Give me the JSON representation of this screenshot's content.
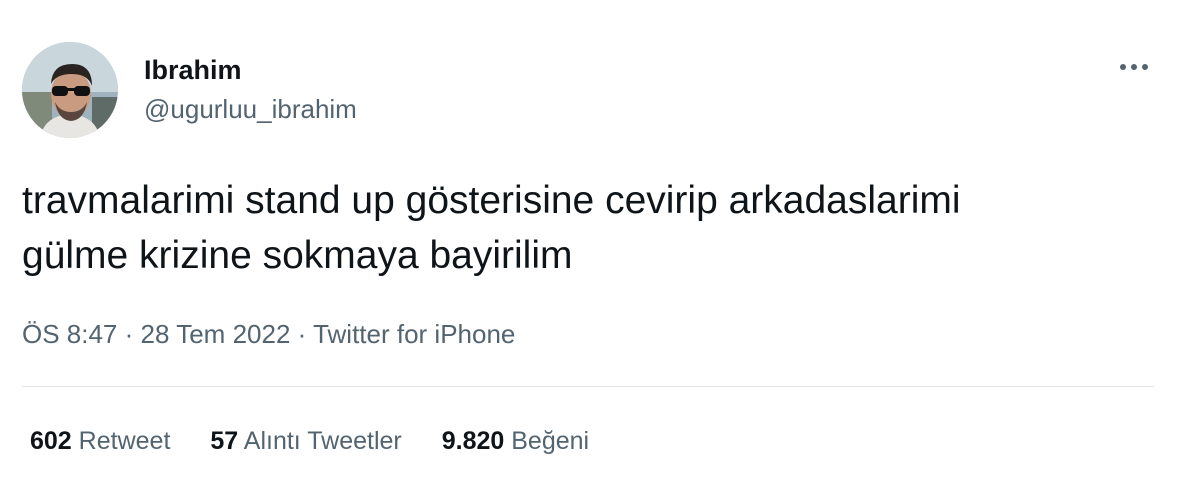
{
  "user": {
    "name": "Ibrahim",
    "handle": "@ugurluu_ibrahim"
  },
  "tweet": {
    "text_line1": "travmalarimi stand up gösterisine cevirip arkadaslarimi",
    "text_line2": "gülme krizine sokmaya bayirilim"
  },
  "meta": {
    "time": "ÖS 8:47",
    "separator": "·",
    "date": "28 Tem 2022",
    "source": "Twitter for iPhone"
  },
  "stats": {
    "retweets_count": "602",
    "retweets_label": "Retweet",
    "quotes_count": "57",
    "quotes_label": "Alıntı Tweetler",
    "likes_count": "9.820",
    "likes_label": "Beğeni"
  },
  "icons": {
    "more": "more-horizontal-icon",
    "avatar": "profile-photo"
  },
  "colors": {
    "text_primary": "#0f1419",
    "text_secondary": "#536471",
    "divider": "#e5e8eb"
  }
}
